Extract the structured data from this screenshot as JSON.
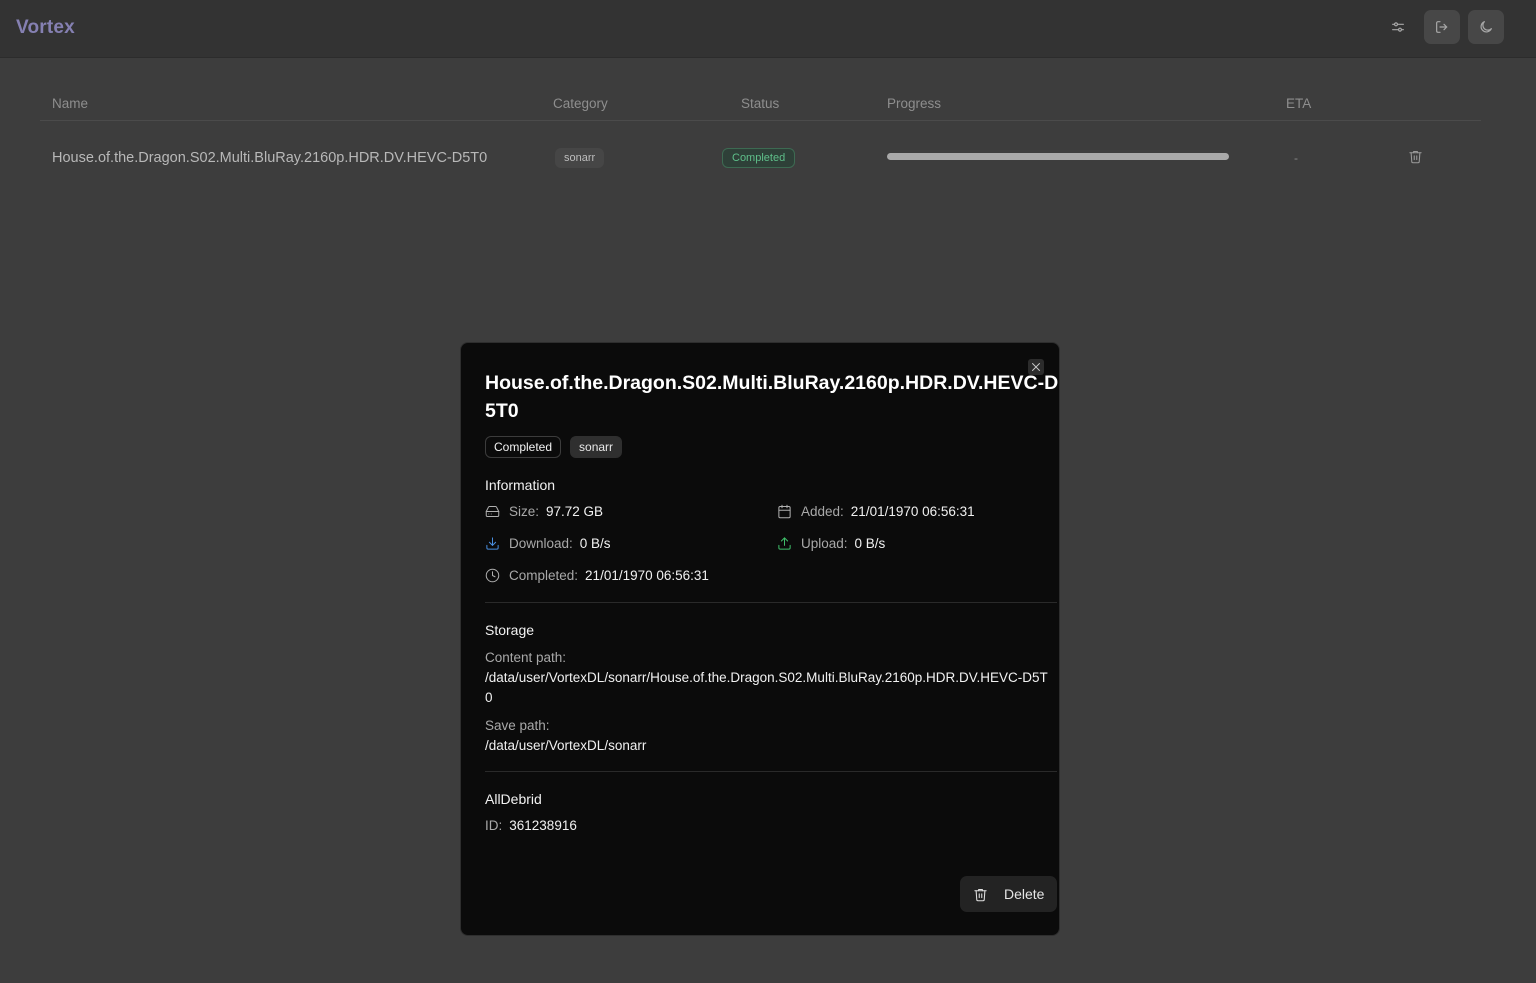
{
  "app": {
    "brand": "Vortex"
  },
  "table": {
    "headers": {
      "name": "Name",
      "category": "Category",
      "status": "Status",
      "progress": "Progress",
      "eta": "ETA"
    },
    "rows": [
      {
        "name": "House.of.the.Dragon.S02.Multi.BluRay.2160p.HDR.DV.HEVC-D5T0",
        "category": "sonarr",
        "status": "Completed",
        "progress": 100,
        "eta": "-"
      }
    ]
  },
  "modal": {
    "title": "House.of.the.Dragon.S02.Multi.BluRay.2160p.HDR.DV.HEVC-D5T0",
    "badges": {
      "status": "Completed",
      "category": "sonarr"
    },
    "information": {
      "title": "Information",
      "size_label": "Size:",
      "size_value": "97.72 GB",
      "added_label": "Added:",
      "added_value": "21/01/1970 06:56:31",
      "download_label": "Download:",
      "download_value": "0 B/s",
      "upload_label": "Upload:",
      "upload_value": "0 B/s",
      "completed_label": "Completed:",
      "completed_value": "21/01/1970 06:56:31"
    },
    "storage": {
      "title": "Storage",
      "content_path_label": "Content path:",
      "content_path_value": "/data/user/VortexDL/sonarr/House.of.the.Dragon.S02.Multi.BluRay.2160p.HDR.DV.HEVC-D5T0",
      "save_path_label": "Save path:",
      "save_path_value": "/data/user/VortexDL/sonarr"
    },
    "alldebrid": {
      "title": "AllDebrid",
      "id_label": "ID:",
      "id_value": "361238916"
    },
    "delete_label": "Delete"
  },
  "colors": {
    "brand": "#8580b2",
    "download_icon": "#4a8fe0",
    "upload_icon": "#3fbf6a",
    "status_green": "#5fbf8a"
  },
  "icons": {
    "settings": "sliders-icon",
    "logout": "logout-icon",
    "theme": "moon-icon"
  }
}
